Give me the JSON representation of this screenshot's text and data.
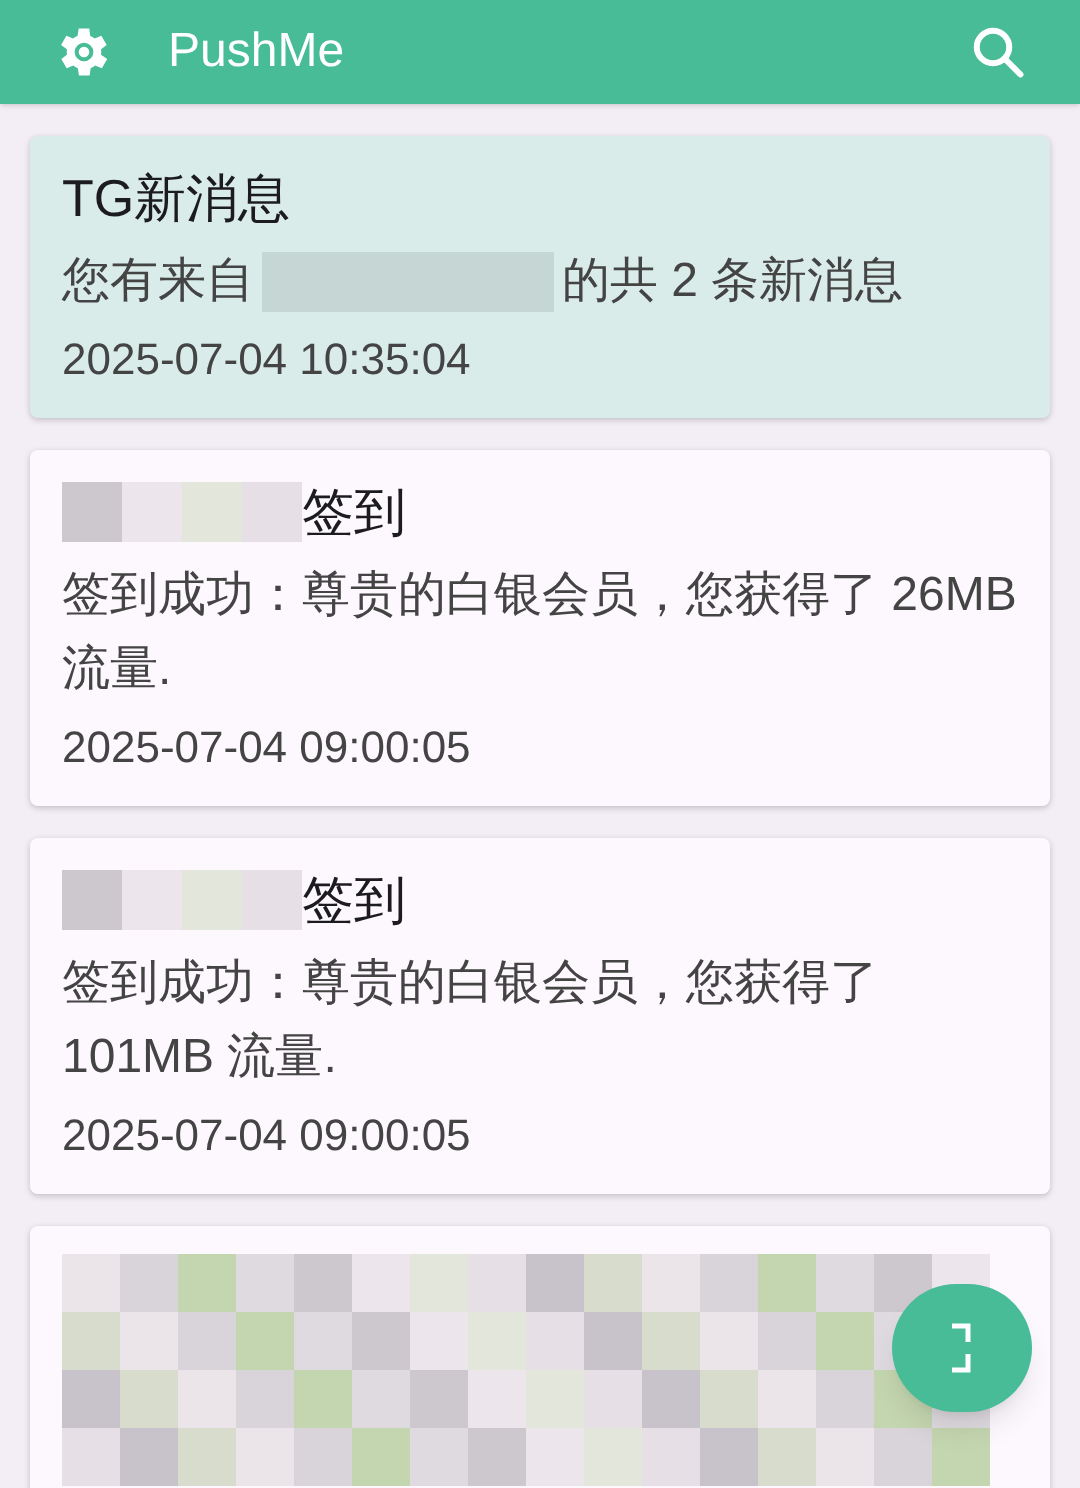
{
  "app_bar": {
    "title": "PushMe"
  },
  "messages": [
    {
      "kind": "message",
      "highlighted": true,
      "title_parts": [
        {
          "text": "TG新消息"
        }
      ],
      "body_parts": [
        {
          "text": "您有来自"
        },
        {
          "redacted": true
        },
        {
          "text": "的共 2 条新消息"
        }
      ],
      "time": "2025-07-04 10:35:04"
    },
    {
      "kind": "message",
      "highlighted": false,
      "title_parts": [
        {
          "redacted": true
        },
        {
          "text": "签到"
        }
      ],
      "body_parts": [
        {
          "text": "签到成功：尊贵的白银会员，您获得了 26MB 流量."
        }
      ],
      "time": "2025-07-04 09:00:05"
    },
    {
      "kind": "message",
      "highlighted": false,
      "title_parts": [
        {
          "redacted": true
        },
        {
          "text": "签到"
        }
      ],
      "body_parts": [
        {
          "text": "签到成功：尊贵的白银会员，您获得了 101MB 流量."
        }
      ],
      "time": "2025-07-04 09:00:05"
    },
    {
      "kind": "redacted",
      "highlighted": false
    }
  ]
}
